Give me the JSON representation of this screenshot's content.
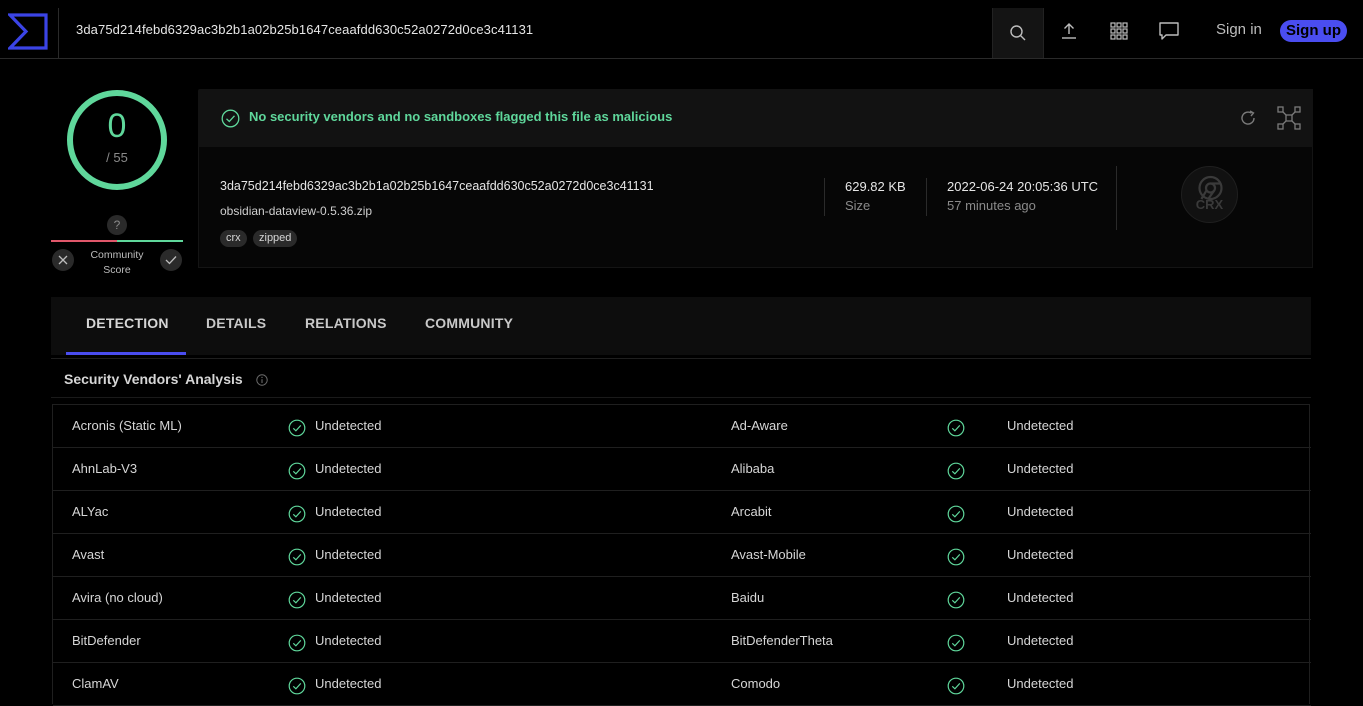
{
  "header": {
    "search_value": "3da75d214febd6329ac3b2b1a02b25b1647ceaafdd630c52a0272d0ce3c41131",
    "signin_label": "Sign in",
    "signup_label": "Sign up",
    "accent_color": "#4a4df0"
  },
  "score": {
    "detections": "0",
    "total": "/ 55",
    "community_question": "?",
    "community_label": "Community Score",
    "ring_color": "#5fd79b"
  },
  "banner": {
    "message": "No security vendors and no sandboxes flagged this file as malicious",
    "color": "#5fd79b"
  },
  "file": {
    "hash": "3da75d214febd6329ac3b2b1a02b25b1647ceaafdd630c52a0272d0ce3c41131",
    "name": "obsidian-dataview-0.5.36.zip",
    "tags": [
      "crx",
      "zipped"
    ],
    "size_value": "629.82 KB",
    "size_label": "Size",
    "date_value": "2022-06-24 20:05:36 UTC",
    "date_label": "57 minutes ago",
    "type_label": "CRX"
  },
  "tabs": [
    "DETECTION",
    "DETAILS",
    "RELATIONS",
    "COMMUNITY"
  ],
  "section": {
    "title": "Security Vendors' Analysis"
  },
  "vendors": [
    {
      "left": {
        "name": "Acronis (Static ML)",
        "result": "Undetected"
      },
      "right": {
        "name": "Ad-Aware",
        "result": "Undetected"
      }
    },
    {
      "left": {
        "name": "AhnLab-V3",
        "result": "Undetected"
      },
      "right": {
        "name": "Alibaba",
        "result": "Undetected"
      }
    },
    {
      "left": {
        "name": "ALYac",
        "result": "Undetected"
      },
      "right": {
        "name": "Arcabit",
        "result": "Undetected"
      }
    },
    {
      "left": {
        "name": "Avast",
        "result": "Undetected"
      },
      "right": {
        "name": "Avast-Mobile",
        "result": "Undetected"
      }
    },
    {
      "left": {
        "name": "Avira (no cloud)",
        "result": "Undetected"
      },
      "right": {
        "name": "Baidu",
        "result": "Undetected"
      }
    },
    {
      "left": {
        "name": "BitDefender",
        "result": "Undetected"
      },
      "right": {
        "name": "BitDefenderTheta",
        "result": "Undetected"
      }
    },
    {
      "left": {
        "name": "ClamAV",
        "result": "Undetected"
      },
      "right": {
        "name": "Comodo",
        "result": "Undetected"
      }
    }
  ]
}
